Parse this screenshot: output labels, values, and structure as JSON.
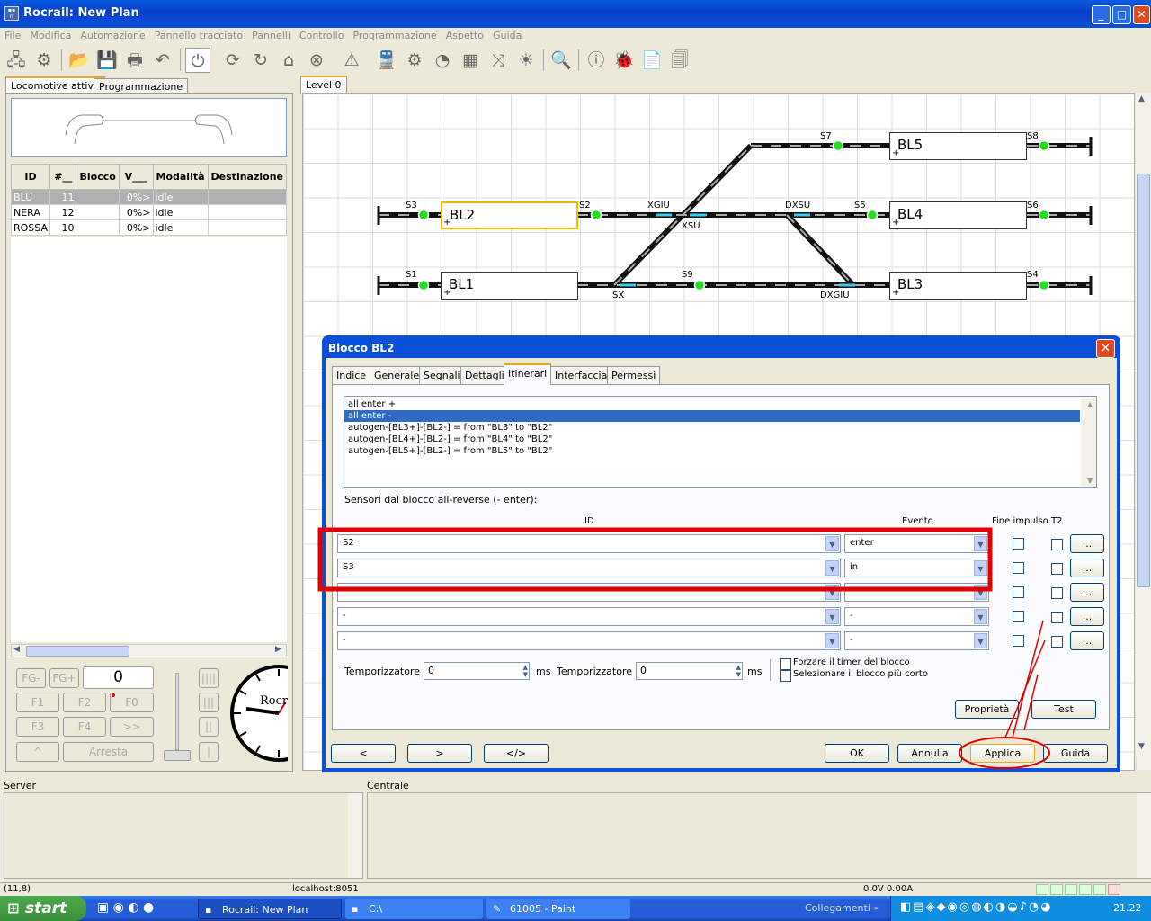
{
  "window": {
    "title": "Rocrail: New Plan",
    "app_icon": "rocrail-icon"
  },
  "menu": [
    "File",
    "Modifica",
    "Automazione",
    "Pannello tracciato",
    "Pannelli",
    "Controllo",
    "Programmazione",
    "Aspetto",
    "Guida"
  ],
  "left_tabs": [
    "Locomotive attive",
    "Programmazione"
  ],
  "loco_table": {
    "headers": [
      "ID",
      "#__",
      "Blocco",
      "V___",
      "Modalità",
      "Destinazione"
    ],
    "rows": [
      {
        "id": "BLU",
        "num": "11",
        "blocco": "",
        "v": "0%>",
        "mode": "idle",
        "dest": ""
      },
      {
        "id": "NERA",
        "num": "12",
        "blocco": "",
        "v": "0%>",
        "mode": "idle",
        "dest": ""
      },
      {
        "id": "ROSSA",
        "num": "10",
        "blocco": "",
        "v": "0%>",
        "mode": "idle",
        "dest": ""
      }
    ]
  },
  "throttle": {
    "fg": "FG-",
    "fgplus": "FG+",
    "speed": "0",
    "f1": "F1",
    "f2": "F2",
    "f0": "F0",
    "f3": "F3",
    "f4": "F4",
    "more": ">>",
    "dir": "^",
    "stop": "Arresta",
    "clock_text": "Rocr"
  },
  "plan_tab": "Level 0",
  "track": {
    "blocks": {
      "BL2": "BL2",
      "BL1": "BL1",
      "BL5": "BL5",
      "BL4": "BL4",
      "BL3": "BL3"
    },
    "labels": {
      "S3": "S3",
      "S2": "S2",
      "XGIU": "XGIU",
      "XSU": "XSU",
      "DXSU": "DXSU",
      "S5": "S5",
      "S6": "S6",
      "S7": "S7",
      "S8": "S8",
      "S1": "S1",
      "SX": "SX",
      "S9": "S9",
      "DXGIU": "DXGIU",
      "S4": "S4"
    },
    "plus": "+"
  },
  "dialog": {
    "title": "Blocco BL2",
    "tabs": [
      "Indice",
      "Generale",
      "Segnali",
      "Dettagli",
      "Itinerari",
      "Interfaccia",
      "Permessi"
    ],
    "routes": [
      "all enter +",
      "all enter -",
      "autogen-[BL3+]-[BL2-] = from \"BL3\" to \"BL2\"",
      "autogen-[BL4+]-[BL2-] = from \"BL4\" to \"BL2\"",
      "autogen-[BL5+]-[BL2-] = from \"BL5\" to \"BL2\""
    ],
    "sensors_label": "Sensori dal blocco all-reverse (- enter):",
    "col_id": "ID",
    "col_event": "Evento",
    "col_fine": "Fine impulso",
    "col_t2": "T2",
    "sensor_rows": [
      {
        "id": "S2",
        "event": "enter"
      },
      {
        "id": "S3",
        "event": "in"
      },
      {
        "id": "-",
        "event": "-"
      },
      {
        "id": "-",
        "event": "-"
      },
      {
        "id": "-",
        "event": "-"
      }
    ],
    "dots": "...",
    "timer1_label": "Temporizzatore 1",
    "timer1_value": "0",
    "timer2_label": "Temporizzatore 2",
    "timer2_value": "0",
    "ms": "ms",
    "force_timer": "Forzare il timer del blocco",
    "shortest_block": "Selezionare il blocco più corto",
    "btn_properties": "Proprietà",
    "btn_test": "Test",
    "btn_prev": "<",
    "btn_next": ">",
    "btn_xml": "</>",
    "btn_ok": "OK",
    "btn_cancel": "Annulla",
    "btn_apply": "Applica",
    "btn_help": "Guida"
  },
  "bottom": {
    "server": "Server",
    "centrale": "Centrale"
  },
  "status": {
    "coords": "(11,8)",
    "host": "localhost:8051",
    "power": "0.0V 0.00A"
  },
  "taskbar": {
    "start": "start",
    "tasks": [
      "Rocrail: New Plan",
      "C:\\",
      "61005 - Paint"
    ],
    "links": "Collegamenti",
    "time": "21.22"
  },
  "colors": {
    "annotation": "#e00000",
    "xp_blue": "#0a4fd8",
    "selection": "#316ac5",
    "sensor_on": "#22dd22",
    "cyan": "#33ccee"
  }
}
